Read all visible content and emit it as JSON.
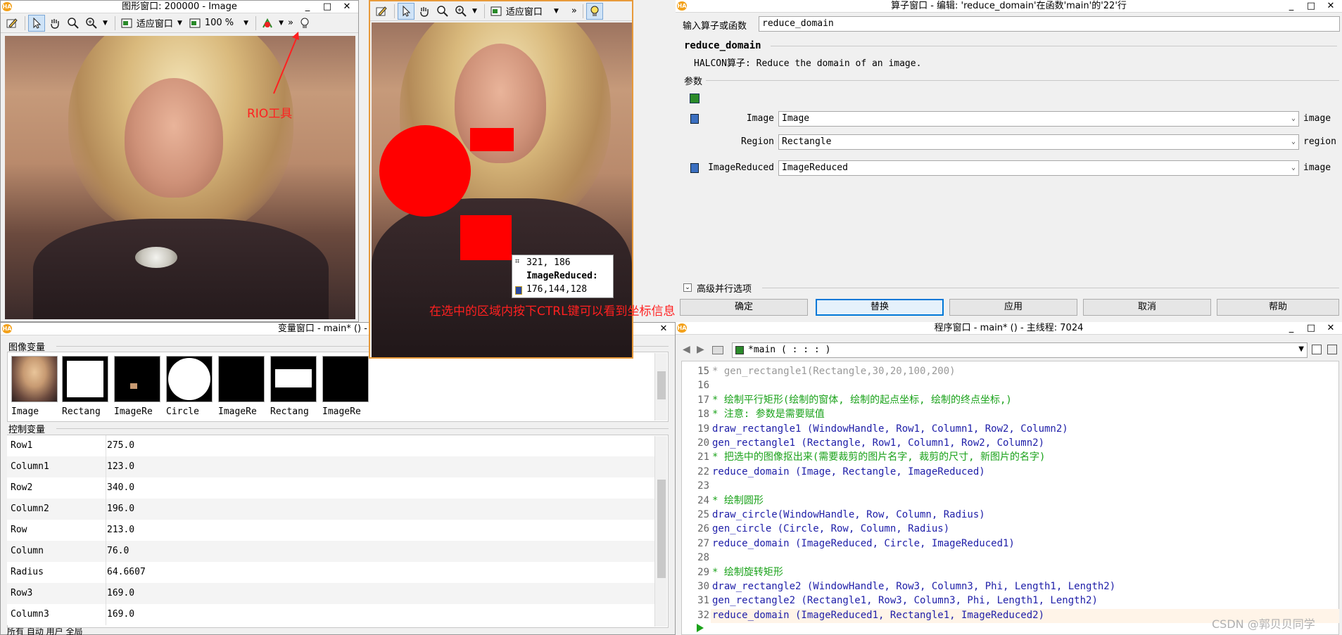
{
  "graphics_window_1": {
    "title": "图形窗口: 200000 - Image",
    "fit_label": "适应窗口",
    "zoom_label": "100 %",
    "controls": [
      "_",
      "□",
      "✕"
    ]
  },
  "graphics_window_2": {
    "fit_label": "适应窗口",
    "tooltip": {
      "coords": "321, 186",
      "title": "ImageReduced:",
      "values": "176,144,128"
    }
  },
  "annotations": {
    "rio_tool": "RIO工具",
    "ctrl_hint": "在选中的区域内按下CTRL键可以看到坐标信息"
  },
  "operator_window": {
    "title": "算子窗口 - 编辑: 'reduce_domain'在函数'main'的'22'行",
    "input_label": "输入算子或函数",
    "input_value": "reduce_domain",
    "op_name": "reduce_domain",
    "op_desc": "HALCON算子: Reduce the domain of an image.",
    "params_label": "参数",
    "params": [
      {
        "name": "Image",
        "value": "Image",
        "type": "image"
      },
      {
        "name": "Region",
        "value": "Rectangle",
        "type": "region"
      },
      {
        "name": "ImageReduced",
        "value": "ImageReduced",
        "type": "image"
      }
    ],
    "advanced_label": "高级并行选项",
    "buttons": [
      "确定",
      "替换",
      "应用",
      "取消",
      "帮助"
    ]
  },
  "variable_window": {
    "title": "变量窗口 - main* () - 主线程",
    "iconic_label": "图像变量",
    "iconic": [
      {
        "label": "Image",
        "kind": "photo"
      },
      {
        "label": "Rectang",
        "kind": "rect-full"
      },
      {
        "label": "ImageRe",
        "kind": "tiny-photo"
      },
      {
        "label": "Circle",
        "kind": "circle"
      },
      {
        "label": "ImageRe",
        "kind": "black"
      },
      {
        "label": "Rectang",
        "kind": "bar"
      },
      {
        "label": "ImageRe",
        "kind": "black"
      }
    ],
    "control_label": "控制变量",
    "control": [
      {
        "name": "Row1",
        "value": "275.0"
      },
      {
        "name": "Column1",
        "value": "123.0"
      },
      {
        "name": "Row2",
        "value": "340.0"
      },
      {
        "name": "Column2",
        "value": "196.0"
      },
      {
        "name": "Row",
        "value": "213.0"
      },
      {
        "name": "Column",
        "value": "76.0"
      },
      {
        "name": "Radius",
        "value": "64.6607"
      },
      {
        "name": "Row3",
        "value": "169.0"
      },
      {
        "name": "Column3",
        "value": "169.0"
      }
    ],
    "bottom_tabs": "所有  自动  用户  全局"
  },
  "program_window": {
    "title": "程序窗口 - main* () - 主线程: 7024",
    "proc_selector": "*main ( : : : )",
    "lines": [
      {
        "n": "15",
        "text": "* gen_rectangle1(Rectangle,30,20,100,200)",
        "kind": "grey"
      },
      {
        "n": "16",
        "text": "",
        "kind": "op"
      },
      {
        "n": "17",
        "text": "* 绘制平行矩形(绘制的窗体, 绘制的起点坐标, 绘制的终点坐标,)",
        "kind": "cm"
      },
      {
        "n": "18",
        "text": "* 注意: 参数是需要赋值",
        "kind": "cm"
      },
      {
        "n": "19",
        "text": "draw_rectangle1 (WindowHandle, Row1, Column1, Row2, Column2)",
        "kind": "op"
      },
      {
        "n": "20",
        "text": "gen_rectangle1 (Rectangle, Row1, Column1, Row2, Column2)",
        "kind": "op"
      },
      {
        "n": "21",
        "text": "* 把选中的图像抠出来(需要裁剪的图片名字, 裁剪的尺寸, 新图片的名字)",
        "kind": "cm"
      },
      {
        "n": "22",
        "text": "reduce_domain (Image, Rectangle, ImageReduced)",
        "kind": "op"
      },
      {
        "n": "23",
        "text": "",
        "kind": "op"
      },
      {
        "n": "24",
        "text": "* 绘制圆形",
        "kind": "cm"
      },
      {
        "n": "25",
        "text": "draw_circle(WindowHandle, Row, Column, Radius)",
        "kind": "op"
      },
      {
        "n": "26",
        "text": "gen_circle (Circle, Row, Column, Radius)",
        "kind": "op"
      },
      {
        "n": "27",
        "text": "reduce_domain (ImageReduced, Circle, ImageReduced1)",
        "kind": "op"
      },
      {
        "n": "28",
        "text": "",
        "kind": "op"
      },
      {
        "n": "29",
        "text": "* 绘制旋转矩形",
        "kind": "cm"
      },
      {
        "n": "30",
        "text": "draw_rectangle2 (WindowHandle, Row3, Column3, Phi, Length1, Length2)",
        "kind": "op"
      },
      {
        "n": "31",
        "text": "gen_rectangle2 (Rectangle1, Row3, Column3, Phi, Length1, Length2)",
        "kind": "op"
      },
      {
        "n": "32",
        "text": "reduce_domain (ImageReduced1, Rectangle1, ImageReduced2)",
        "kind": "op"
      }
    ]
  },
  "watermark": "CSDN @郭贝贝同学",
  "colors": {
    "region_red": "#ff0000",
    "comment_green": "#1aa21a",
    "operator_blue": "#1e1ea8",
    "window_border_orange": "#f3a11b"
  }
}
